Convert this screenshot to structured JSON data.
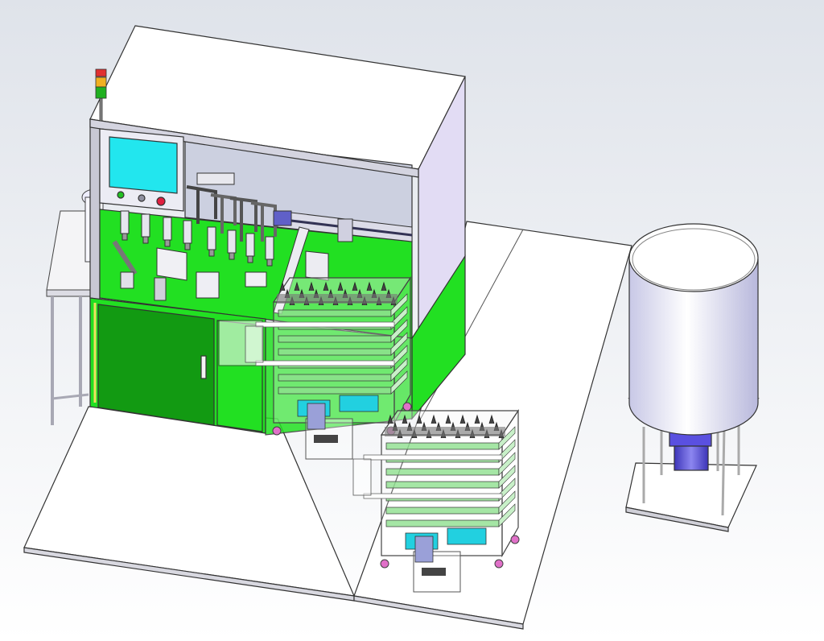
{
  "scene": {
    "background_top": "#dfe3ea",
    "background_bottom": "#ffffff",
    "floor_color": "#ffffff",
    "accent_green": "#22e022",
    "dark_green": "#129a12",
    "screen_cyan": "#22e6ee",
    "tank_motor_blue": "#5a50e0",
    "stack_light_colors": [
      "#e03030",
      "#f0b020",
      "#20b020"
    ]
  },
  "components": [
    {
      "name": "main-assembly-machine",
      "icon": "machine-icon"
    },
    {
      "name": "hmi-touch-screen",
      "icon": "monitor-icon"
    },
    {
      "name": "signal-tower-light",
      "icon": "stack-light-icon"
    },
    {
      "name": "tray-rack-cart",
      "icon": "cart-icon",
      "count": 2
    },
    {
      "name": "storage-tank",
      "icon": "tank-icon"
    },
    {
      "name": "side-workbench",
      "icon": "table-icon"
    }
  ]
}
